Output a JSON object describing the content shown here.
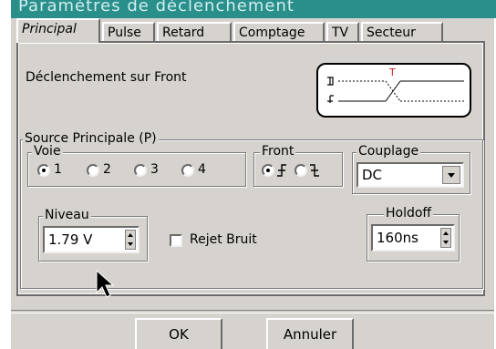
{
  "window": {
    "title": "Paramètres de déclenchement"
  },
  "tabs": [
    {
      "label": "Principal"
    },
    {
      "label": "Pulse"
    },
    {
      "label": "Retard"
    },
    {
      "label": "Comptage"
    },
    {
      "label": "TV"
    },
    {
      "label": "Secteur"
    }
  ],
  "trigger": {
    "label": "Déclenchement sur Front",
    "marker": "T"
  },
  "source": {
    "legend": "Source Principale (P)",
    "voie": {
      "legend": "Voie",
      "options": [
        "1",
        "2",
        "3",
        "4"
      ],
      "selected": "1"
    },
    "front": {
      "legend": "Front",
      "selected": "rising"
    },
    "couplage": {
      "legend": "Couplage",
      "value": "DC"
    }
  },
  "niveau": {
    "legend": "Niveau",
    "value": "1.79 V"
  },
  "rejet": {
    "label": "Rejet Bruit",
    "checked": false
  },
  "holdoff": {
    "legend": "Holdoff",
    "value": "160ns"
  },
  "buttons": {
    "ok": "OK",
    "cancel": "Annuler"
  }
}
